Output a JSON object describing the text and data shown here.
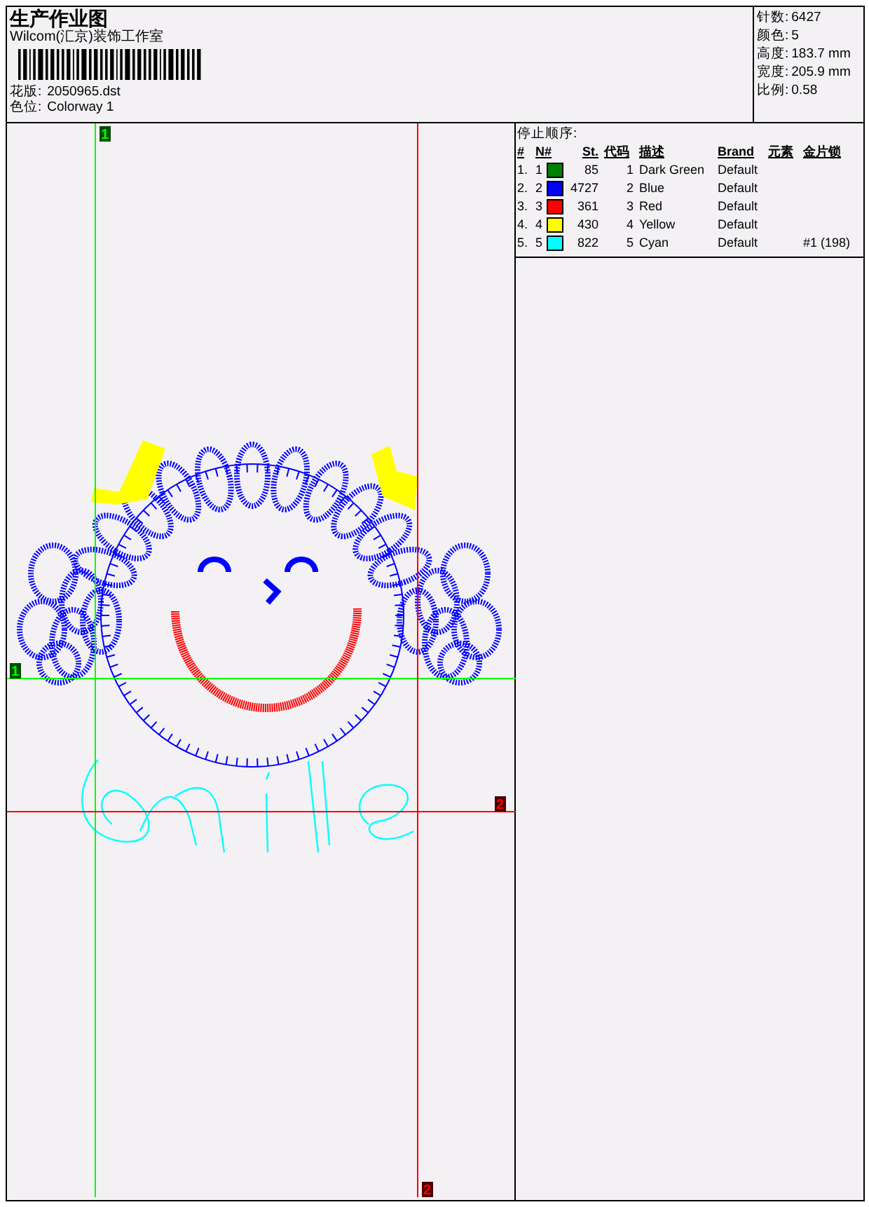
{
  "header": {
    "title": "生产作业图",
    "company": "Wilcom(汇京)装饰工作室",
    "design_label": "花版:",
    "design_value": "2050965.dst",
    "colorway_label": "色位:",
    "colorway_value": "Colorway 1"
  },
  "stats": [
    {
      "label": "针数:",
      "value": "6427"
    },
    {
      "label": "颜色:",
      "value": "5"
    },
    {
      "label": "高度:",
      "value": "183.7 mm"
    },
    {
      "label": "宽度:",
      "value": "205.9 mm"
    },
    {
      "label": "比例:",
      "value": "0.58"
    }
  ],
  "guides": [
    {
      "label": "1",
      "color": "#00ff00"
    },
    {
      "label": "1",
      "color": "#00ff00"
    },
    {
      "label": "2",
      "color": "#ff0000"
    },
    {
      "label": "2",
      "color": "#ff0000"
    }
  ],
  "stop_sequence": {
    "title": "停止顺序:",
    "columns": [
      "#",
      "N#",
      "St.",
      "代码",
      "描述",
      "Brand",
      "元素",
      "金片锁"
    ],
    "rows": [
      {
        "index": "1.",
        "number": "1",
        "color": "#008000",
        "stitches": "85",
        "code": "1",
        "description": "Dark Green",
        "brand": "Default"
      },
      {
        "index": "2.",
        "number": "2",
        "color": "#0000ff",
        "stitches": "4727",
        "code": "2",
        "description": "Blue",
        "brand": "Default"
      },
      {
        "index": "3.",
        "number": "3",
        "color": "#ff0000",
        "stitches": "361",
        "code": "3",
        "description": "Red",
        "brand": "Default"
      },
      {
        "index": "4.",
        "number": "4",
        "color": "#ffff00",
        "stitches": "430",
        "code": "4",
        "description": "Yellow",
        "brand": "Default"
      },
      {
        "index": "5.",
        "number": "5",
        "color": "#00ffff",
        "stitches": "822",
        "code": "5",
        "description": "Cyan",
        "brand": "Default",
        "sequin": "#1 (198)"
      }
    ]
  }
}
